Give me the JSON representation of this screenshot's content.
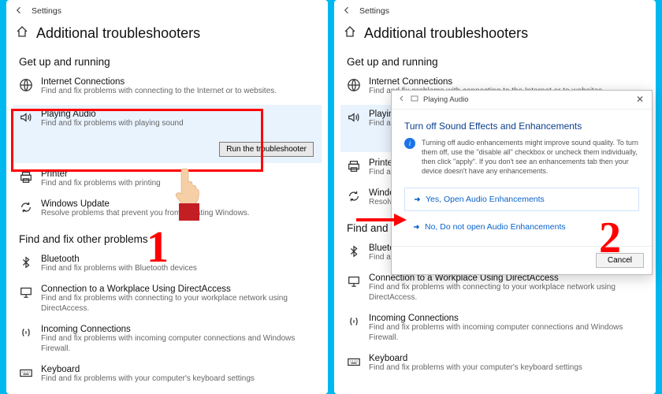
{
  "topbar": {
    "title": "Settings"
  },
  "header": {
    "title": "Additional troubleshooters"
  },
  "section1": "Get up and running",
  "section2": "Find and fix other problems",
  "items": {
    "internet": {
      "title": "Internet Connections",
      "desc": "Find and fix problems with connecting to the Internet or to websites."
    },
    "audio": {
      "title": "Playing Audio",
      "desc": "Find and fix problems with playing sound"
    },
    "printer": {
      "title": "Printer",
      "desc": "Find and fix problems with printing"
    },
    "wu": {
      "title": "Windows Update",
      "desc": "Resolve problems that prevent you from updating Windows."
    },
    "wu_trunc": {
      "desc": "Resolve problems that prevent"
    },
    "bt": {
      "title": "Bluetooth",
      "desc": "Find and fix problems with Bluetooth devices"
    },
    "da": {
      "title": "Connection to a Workplace Using DirectAccess",
      "desc": "Find and fix problems with connecting to your workplace network using DirectAccess."
    },
    "inc": {
      "title": "Incoming Connections",
      "desc": "Find and fix problems with incoming computer connections and Windows Firewall."
    },
    "kbd": {
      "title": "Keyboard",
      "desc": "Find and fix problems with your computer's keyboard settings"
    }
  },
  "audio_trunc_desc": "Find and fix problems with playing",
  "run_btn": "Run the troubleshooter",
  "dialog": {
    "breadcrumb": "Playing Audio",
    "heading": "Turn off Sound Effects and Enhancements",
    "info": "Turning off audio enhancements might improve sound quality. To turn them off, use the \"disable all\" checkbox or uncheck them individually, then click \"apply\". If you don't see an enhancements tab then your device doesn't have any enhancements.",
    "opt_yes": "Yes, Open Audio Enhancements",
    "opt_no": "No, Do not open Audio Enhancements",
    "cancel": "Cancel"
  },
  "step1": "1",
  "step2": "2"
}
